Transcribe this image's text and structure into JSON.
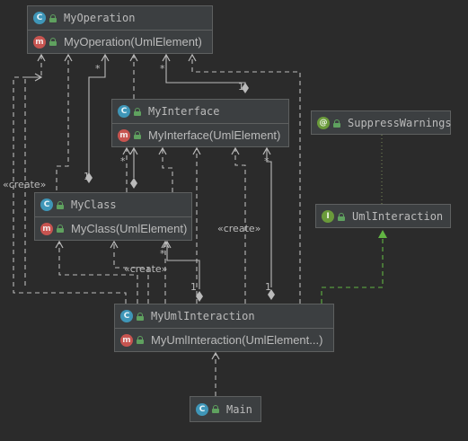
{
  "nodes": {
    "my_operation": {
      "name": "MyOperation",
      "kind": "class",
      "method": "MyOperation(UmlElement)"
    },
    "my_interface": {
      "name": "MyInterface",
      "kind": "class",
      "method": "MyInterface(UmlElement)"
    },
    "suppress_warnings": {
      "name": "SuppressWarnings",
      "kind": "annotation"
    },
    "my_class": {
      "name": "MyClass",
      "kind": "class",
      "method": "MyClass(UmlElement)"
    },
    "uml_interaction": {
      "name": "UmlInteraction",
      "kind": "interface"
    },
    "my_uml_interaction": {
      "name": "MyUmlInteraction",
      "kind": "class",
      "method": "MyUmlInteraction(UmlElement...)"
    },
    "main": {
      "name": "Main",
      "kind": "class"
    }
  },
  "labels": {
    "create_left": "«create»",
    "create_mid": "«create»",
    "create_right": "«create»",
    "mult_star": "*",
    "mult_one": "1"
  },
  "colors": {
    "background": "#2b2b2b",
    "node_fill": "#3c3f41",
    "edge": "#bbbbbb",
    "implements_edge": "#62b543"
  }
}
